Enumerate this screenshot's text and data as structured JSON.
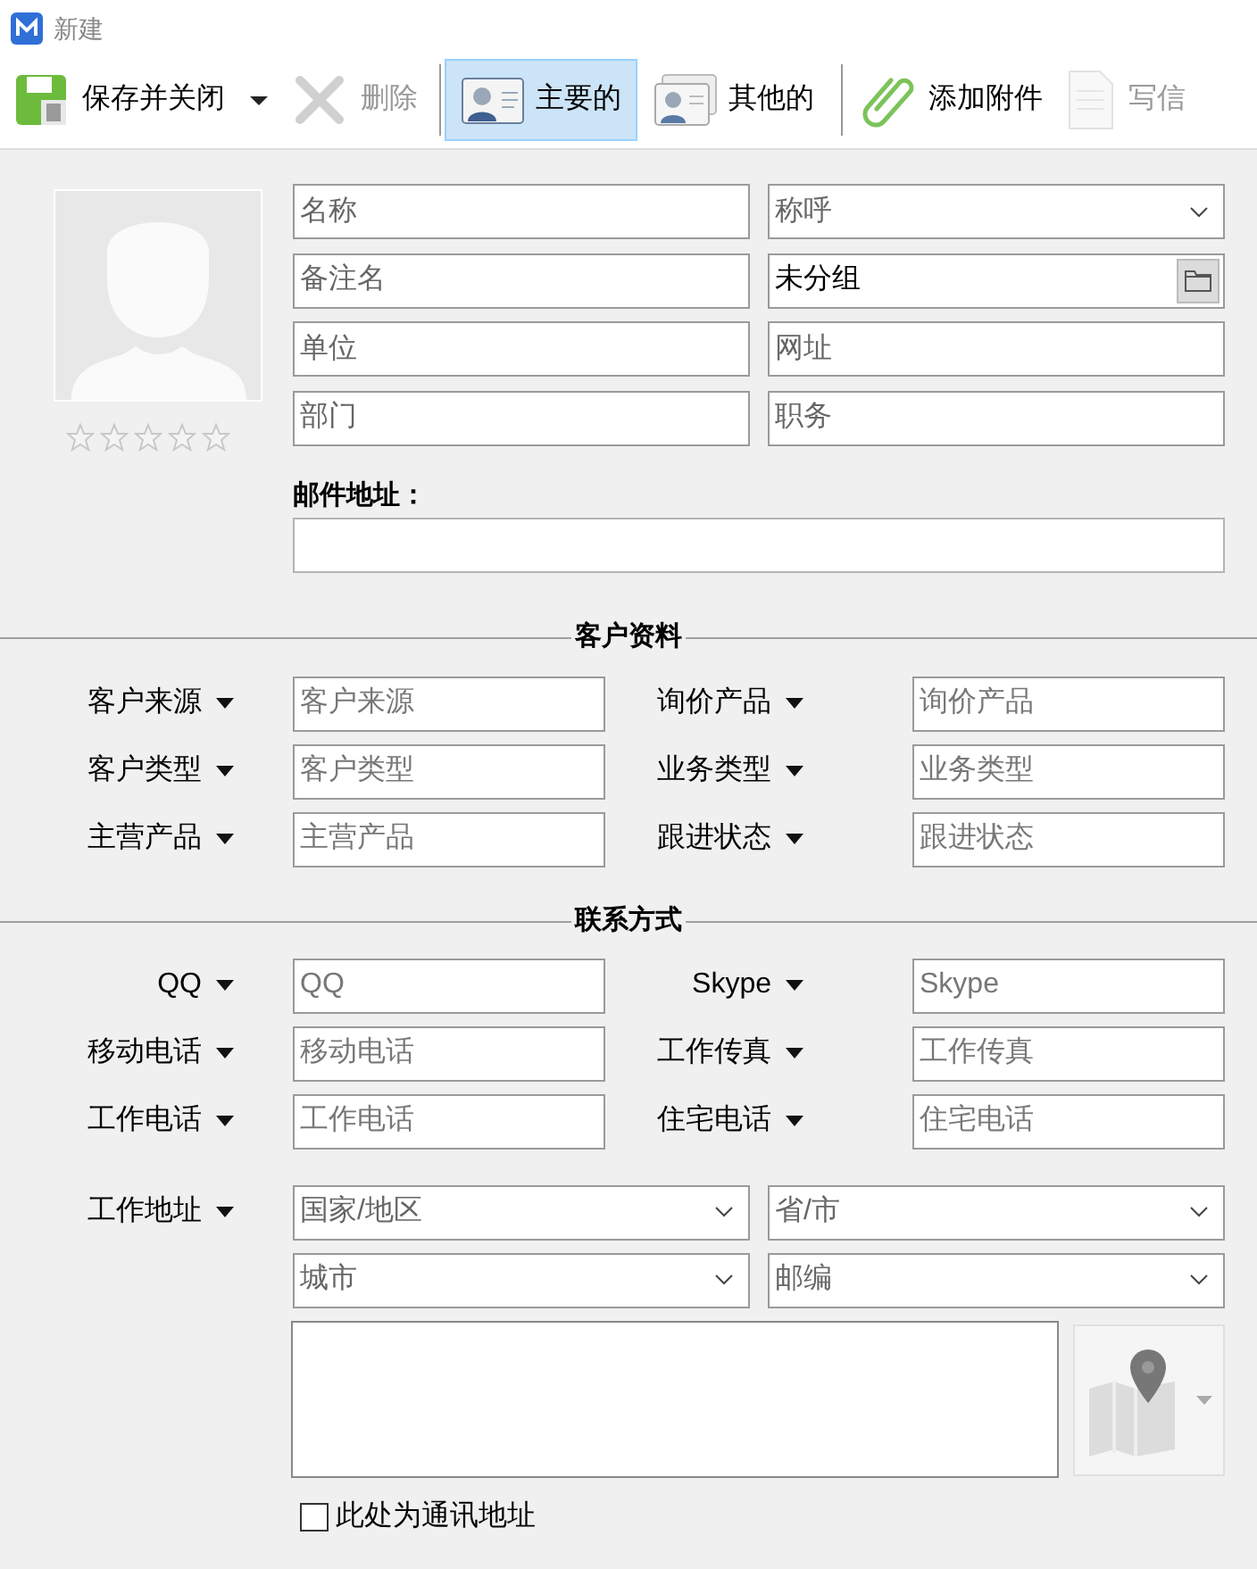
{
  "window": {
    "title": "新建"
  },
  "toolbar": {
    "left": [
      {
        "kind": "save",
        "label": "保存并关闭",
        "disabled": false,
        "dropdown": true
      },
      {
        "kind": "delete",
        "label": "删除",
        "disabled": true,
        "dropdown": false
      }
    ],
    "tabs": [
      {
        "label": "主要的",
        "selected": true
      },
      {
        "label": "其他的",
        "selected": false
      }
    ],
    "right": [
      {
        "kind": "attach",
        "label": "添加附件",
        "disabled": false,
        "dropdown": false
      },
      {
        "kind": "compose",
        "label": "写信",
        "disabled": true,
        "dropdown": false
      }
    ]
  },
  "contact": {
    "stars": 0,
    "fields": [
      {
        "kind": "text",
        "placeholder": "名称"
      },
      {
        "kind": "select",
        "placeholder": "称呼"
      },
      {
        "kind": "text",
        "placeholder": "备注名"
      },
      {
        "kind": "group",
        "value": "未分组"
      },
      {
        "kind": "text",
        "placeholder": "单位"
      },
      {
        "kind": "text",
        "placeholder": "网址"
      },
      {
        "kind": "text",
        "placeholder": "部门"
      },
      {
        "kind": "text",
        "placeholder": "职务"
      }
    ],
    "email": {
      "label": "邮件地址："
    }
  },
  "sections": [
    {
      "title": "客户资料",
      "fields": [
        {
          "label": "客户来源",
          "placeholder": "客户来源"
        },
        {
          "label": "询价产品",
          "placeholder": "询价产品"
        },
        {
          "label": "客户类型",
          "placeholder": "客户类型"
        },
        {
          "label": "业务类型",
          "placeholder": "业务类型"
        },
        {
          "label": "主营产品",
          "placeholder": "主营产品"
        },
        {
          "label": "跟进状态",
          "placeholder": "跟进状态"
        }
      ]
    },
    {
      "title": "联系方式",
      "fields": [
        {
          "label": "QQ",
          "placeholder": "QQ"
        },
        {
          "label": "Skype",
          "placeholder": "Skype"
        },
        {
          "label": "移动电话",
          "placeholder": "移动电话"
        },
        {
          "label": "工作传真",
          "placeholder": "工作传真"
        },
        {
          "label": "工作电话",
          "placeholder": "工作电话"
        },
        {
          "label": "住宅电话",
          "placeholder": "住宅电话"
        }
      ]
    }
  ],
  "address": {
    "label": "工作地址",
    "selects": [
      {
        "placeholder": "国家/地区"
      },
      {
        "placeholder": "省/市"
      },
      {
        "placeholder": "城市"
      },
      {
        "placeholder": "邮编"
      }
    ],
    "mailing_address": {
      "label": "此处为通讯地址",
      "checked": false
    }
  }
}
